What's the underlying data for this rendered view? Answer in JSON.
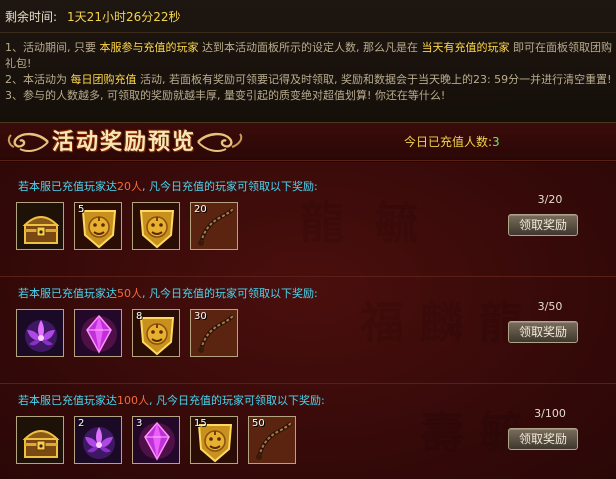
{
  "timer": {
    "label": "剩余时间:",
    "value": "1天21小时26分22秒"
  },
  "rules": [
    [
      "1、活动期间, 只要 ",
      "本服参与充值的玩家",
      " 达到本活动面板所示的设定人数, 那么凡是在 ",
      "当天有充值的玩家",
      " 即可在面板领取团购礼包!"
    ],
    [
      "2、本活动为 ",
      "每日团购充值",
      " 活动, 若面板有奖励可领要记得及时领取, 奖励和数据会于当天晚上的23: 59分一并进行清空重置!"
    ],
    [
      "3、参与的人数越多, 可领取的奖励就越丰厚, 量变引起的质变绝对超值划算! 你还在等什么!",
      "",
      "",
      "",
      ""
    ]
  ],
  "header": {
    "title": "活动奖励预览",
    "count_label": "今日已充值人数:",
    "count_value": "3"
  },
  "claim_label": "领取奖励",
  "tiers": [
    {
      "prefix": "若本服已充值玩家达",
      "target": "20人",
      "suffix": ", 凡今日充值的玩家可领取以下奖励:",
      "progress": "3/20",
      "items": [
        {
          "icon": "treasure-chest-icon",
          "qty": ""
        },
        {
          "icon": "lion-badge-icon",
          "qty": "5"
        },
        {
          "icon": "lion-badge-icon",
          "qty": ""
        },
        {
          "icon": "whip-icon",
          "qty": "20"
        }
      ]
    },
    {
      "prefix": "若本服已充值玩家达",
      "target": "50人",
      "suffix": ", 凡今日充值的玩家可领取以下奖励:",
      "progress": "3/50",
      "items": [
        {
          "icon": "lotus-icon",
          "qty": ""
        },
        {
          "icon": "purple-gem-icon",
          "qty": ""
        },
        {
          "icon": "lion-badge-icon",
          "qty": "8"
        },
        {
          "icon": "whip-icon",
          "qty": "30"
        }
      ]
    },
    {
      "prefix": "若本服已充值玩家达",
      "target": "100人",
      "suffix": ", 凡今日充值的玩家可领取以下奖励:",
      "progress": "3/100",
      "items": [
        {
          "icon": "treasure-chest-icon",
          "qty": ""
        },
        {
          "icon": "lotus-icon",
          "qty": "2"
        },
        {
          "icon": "purple-gem-icon",
          "qty": "3"
        },
        {
          "icon": "lion-badge-icon",
          "qty": "15"
        },
        {
          "icon": "whip-icon",
          "qty": "50"
        }
      ]
    }
  ]
}
